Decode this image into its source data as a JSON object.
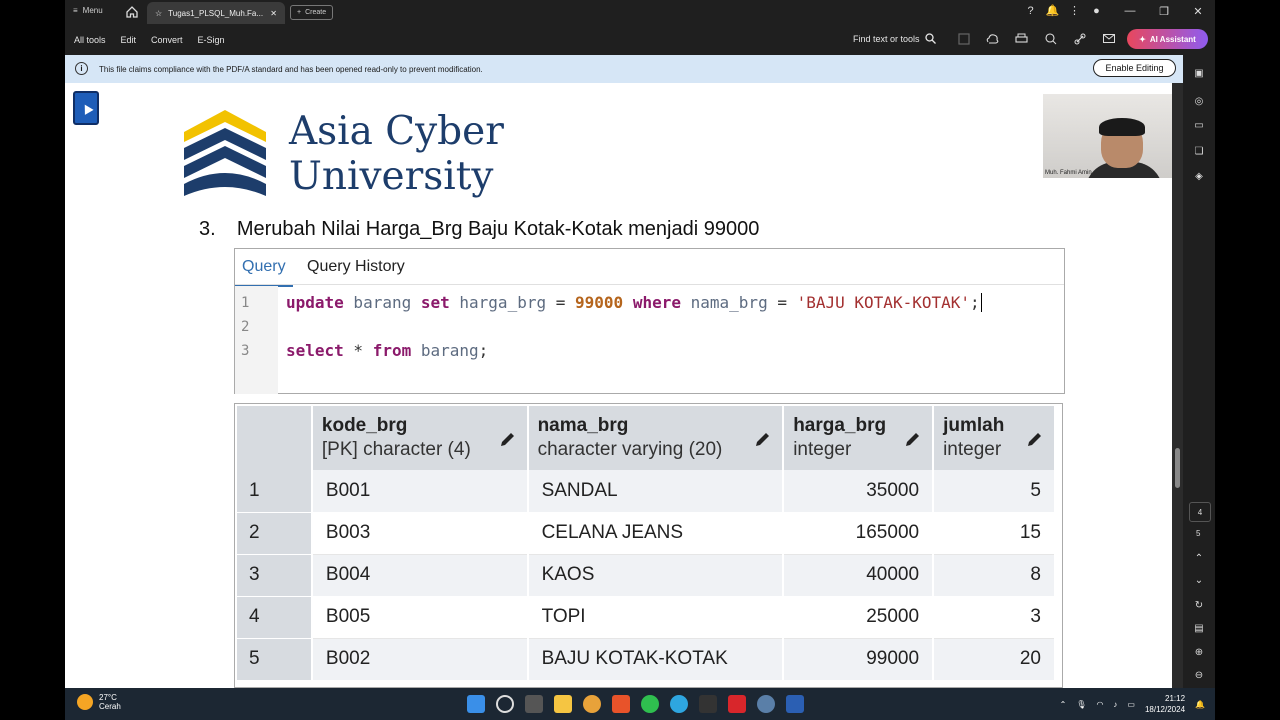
{
  "titlebar": {
    "menu_label": "Menu",
    "tab_title": "Tugas1_PLSQL_Muh.Fa...",
    "create_label": "Create"
  },
  "toolbar": {
    "menus": [
      "All tools",
      "Edit",
      "Convert",
      "E-Sign"
    ],
    "find_label": "Find text or tools",
    "ai_label": "AI Assistant"
  },
  "notice": {
    "message": "This file claims compliance with the PDF/A standard and has been opened read-only to prevent modification.",
    "enable_label": "Enable Editing"
  },
  "document": {
    "logo_line1": "Asia Cyber",
    "logo_line2": "University",
    "heading_number": "3.",
    "heading_text": "Merubah Nilai Harga_Brg Baju Kotak-Kotak menjadi 99000"
  },
  "query_panel": {
    "tab_query": "Query",
    "tab_history": "Query History",
    "line_numbers": [
      "1",
      "2",
      "3"
    ],
    "line1": {
      "k1": "update",
      "t1": " barang ",
      "k2": "set",
      "t2": " harga_brg ",
      "op1": "=",
      "sp1": " ",
      "n1": "99000",
      "sp2": " ",
      "k3": "where",
      "t3": " nama_brg ",
      "op2": "=",
      "sp3": " ",
      "s1": "'BAJU KOTAK-KOTAK'",
      "end": ";"
    },
    "line3": {
      "k1": "select",
      "op1": " * ",
      "k2": "from",
      "t1": " barang",
      "end": ";"
    }
  },
  "result": {
    "columns": [
      {
        "name": "kode_brg",
        "type": "[PK] character (4)"
      },
      {
        "name": "nama_brg",
        "type": "character varying (20)"
      },
      {
        "name": "harga_brg",
        "type": "integer"
      },
      {
        "name": "jumlah",
        "type": "integer"
      }
    ],
    "rows": [
      {
        "n": "1",
        "kode": "B001",
        "nama": "SANDAL",
        "harga": "35000",
        "jumlah": "5"
      },
      {
        "n": "2",
        "kode": "B003",
        "nama": "CELANA JEANS",
        "harga": "165000",
        "jumlah": "15"
      },
      {
        "n": "3",
        "kode": "B004",
        "nama": "KAOS",
        "harga": "40000",
        "jumlah": "8"
      },
      {
        "n": "4",
        "kode": "B005",
        "nama": "TOPI",
        "harga": "25000",
        "jumlah": "3"
      },
      {
        "n": "5",
        "kode": "B002",
        "nama": "BAJU KOTAK-KOTAK",
        "harga": "99000",
        "jumlah": "20"
      }
    ]
  },
  "webcam": {
    "name": "Muh. Fahmi Amin"
  },
  "sidebar": {
    "page_current": "4",
    "page_total": "5"
  },
  "taskbar": {
    "temperature": "27°C",
    "weather": "Cerah",
    "time": "21:12",
    "date": "18/12/2024"
  },
  "colors": {
    "accent": "#326fb0",
    "ai_button": "#e8475d",
    "notice_bg": "#d6e6f6"
  }
}
